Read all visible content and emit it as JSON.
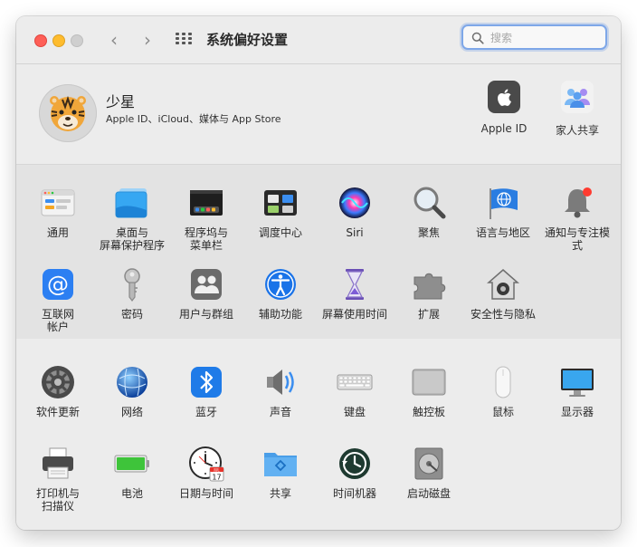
{
  "window": {
    "title": "系统偏好设置"
  },
  "search": {
    "placeholder": "搜索"
  },
  "account": {
    "name": "少星",
    "subtitle": "Apple ID、iCloud、媒体与 App Store",
    "apple_id_label": "Apple ID",
    "family_label": "家人共享"
  },
  "section1": [
    {
      "name": "general",
      "l1": "通用",
      "l2": ""
    },
    {
      "name": "desktop-screensaver",
      "l1": "桌面与",
      "l2": "屏幕保护程序"
    },
    {
      "name": "dock-menubar",
      "l1": "程序坞与",
      "l2": "菜单栏"
    },
    {
      "name": "mission-control",
      "l1": "调度中心",
      "l2": ""
    },
    {
      "name": "siri",
      "l1": "Siri",
      "l2": ""
    },
    {
      "name": "spotlight",
      "l1": "聚焦",
      "l2": ""
    },
    {
      "name": "language-region",
      "l1": "语言与地区",
      "l2": ""
    },
    {
      "name": "notifications",
      "l1": "通知与专注模式",
      "l2": ""
    },
    {
      "name": "internet-accounts",
      "l1": "互联网",
      "l2": "帐户"
    },
    {
      "name": "passwords",
      "l1": "密码",
      "l2": ""
    },
    {
      "name": "users-groups",
      "l1": "用户与群组",
      "l2": ""
    },
    {
      "name": "accessibility",
      "l1": "辅助功能",
      "l2": ""
    },
    {
      "name": "screen-time",
      "l1": "屏幕使用时间",
      "l2": ""
    },
    {
      "name": "extensions",
      "l1": "扩展",
      "l2": ""
    },
    {
      "name": "security-privacy",
      "l1": "安全性与隐私",
      "l2": ""
    }
  ],
  "section2": [
    {
      "name": "software-update",
      "l1": "软件更新",
      "l2": ""
    },
    {
      "name": "network",
      "l1": "网络",
      "l2": ""
    },
    {
      "name": "bluetooth",
      "l1": "蓝牙",
      "l2": ""
    },
    {
      "name": "sound",
      "l1": "声音",
      "l2": ""
    },
    {
      "name": "keyboard",
      "l1": "键盘",
      "l2": ""
    },
    {
      "name": "trackpad",
      "l1": "触控板",
      "l2": ""
    },
    {
      "name": "mouse",
      "l1": "鼠标",
      "l2": ""
    },
    {
      "name": "displays",
      "l1": "显示器",
      "l2": ""
    },
    {
      "name": "printers-scanners",
      "l1": "打印机与",
      "l2": "扫描仪"
    },
    {
      "name": "battery",
      "l1": "电池",
      "l2": ""
    },
    {
      "name": "date-time",
      "l1": "日期与时间",
      "l2": ""
    },
    {
      "name": "sharing",
      "l1": "共享",
      "l2": ""
    },
    {
      "name": "time-machine",
      "l1": "时间机器",
      "l2": ""
    },
    {
      "name": "startup-disk",
      "l1": "启动磁盘",
      "l2": ""
    }
  ],
  "icons": {
    "date_badge_month": "JUL",
    "date_badge_day": "17"
  }
}
